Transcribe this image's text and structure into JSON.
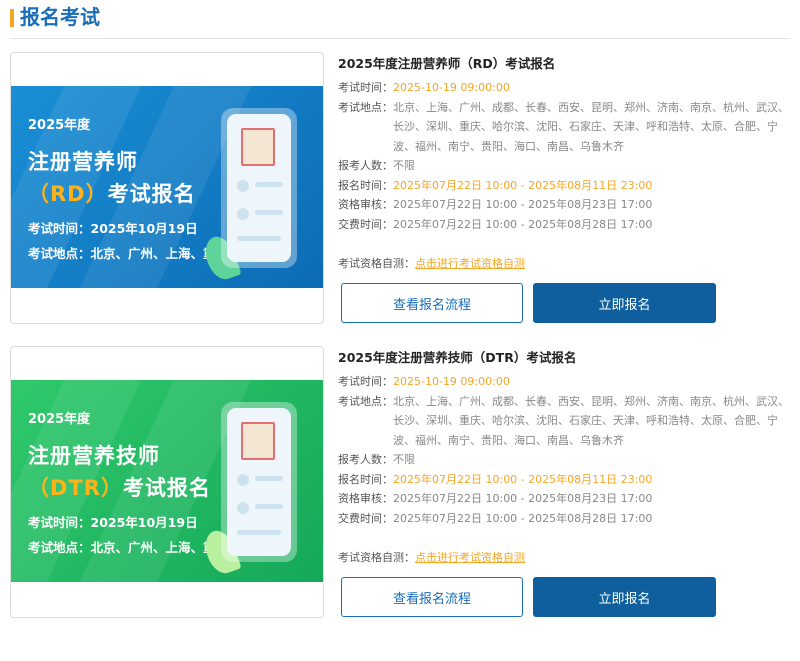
{
  "header": {
    "title": "报名考试"
  },
  "exams": [
    {
      "banner": {
        "year": "2025年度",
        "name_line": "注册营养师",
        "code": "（RD）",
        "name_rest": "考试报名",
        "time_line": "考试时间：2025年10月19日",
        "place_line": "考试地点：北京、广州、上海、重庆、南京等",
        "theme": "blue"
      },
      "title": "2025年度注册营养师（RD）考试报名",
      "exam_time_label": "考试时间：",
      "exam_time": "2025-10-19 09:00:00",
      "place_label": "考试地点：",
      "place": "北京、上海、广州、成都、长春、西安、昆明、郑州、济南、南京、杭州、武汉、长沙、深圳、重庆、哈尔滨、沈阳、石家庄、天津、呼和浩特、太原、合肥、宁波、福州、南宁、贵阳、海口、南昌、乌鲁木齐",
      "count_label": "报考人数：",
      "count": "不限",
      "reg_label": "报名时间：",
      "reg_time": "2025年07月22日 10:00 - 2025年08月11日 23:00",
      "review_label": "资格审核：",
      "review_time": "2025年07月22日 10:00 - 2025年08月23日 17:00",
      "pay_label": "交费时间：",
      "pay_time": "2025年07月22日 10:00 - 2025年08月28日 17:00",
      "self_check_label": "考试资格自测：",
      "self_check_link": "点击进行考试资格自测",
      "btn_flow": "查看报名流程",
      "btn_apply": "立即报名"
    },
    {
      "banner": {
        "year": "2025年度",
        "name_line": "注册营养技师",
        "code": "（DTR）",
        "name_rest": "考试报名",
        "time_line": "考试时间：2025年10月19日",
        "place_line": "考试地点：北京、广州、上海、重庆、南京等",
        "theme": "green"
      },
      "title": "2025年度注册营养技师（DTR）考试报名",
      "exam_time_label": "考试时间：",
      "exam_time": "2025-10-19 09:00:00",
      "place_label": "考试地点：",
      "place": "北京、上海、广州、成都、长春、西安、昆明、郑州、济南、南京、杭州、武汉、长沙、深圳、重庆、哈尔滨、沈阳、石家庄、天津、呼和浩特、太原、合肥、宁波、福州、南宁、贵阳、海口、南昌、乌鲁木齐",
      "count_label": "报考人数：",
      "count": "不限",
      "reg_label": "报名时间：",
      "reg_time": "2025年07月22日 10:00 - 2025年08月11日 23:00",
      "review_label": "资格审核：",
      "review_time": "2025年07月22日 10:00 - 2025年08月23日 17:00",
      "pay_label": "交费时间：",
      "pay_time": "2025年07月22日 10:00 - 2025年08月28日 17:00",
      "self_check_label": "考试资格自测：",
      "self_check_link": "点击进行考试资格自测",
      "btn_flow": "查看报名流程",
      "btn_apply": "立即报名"
    }
  ]
}
